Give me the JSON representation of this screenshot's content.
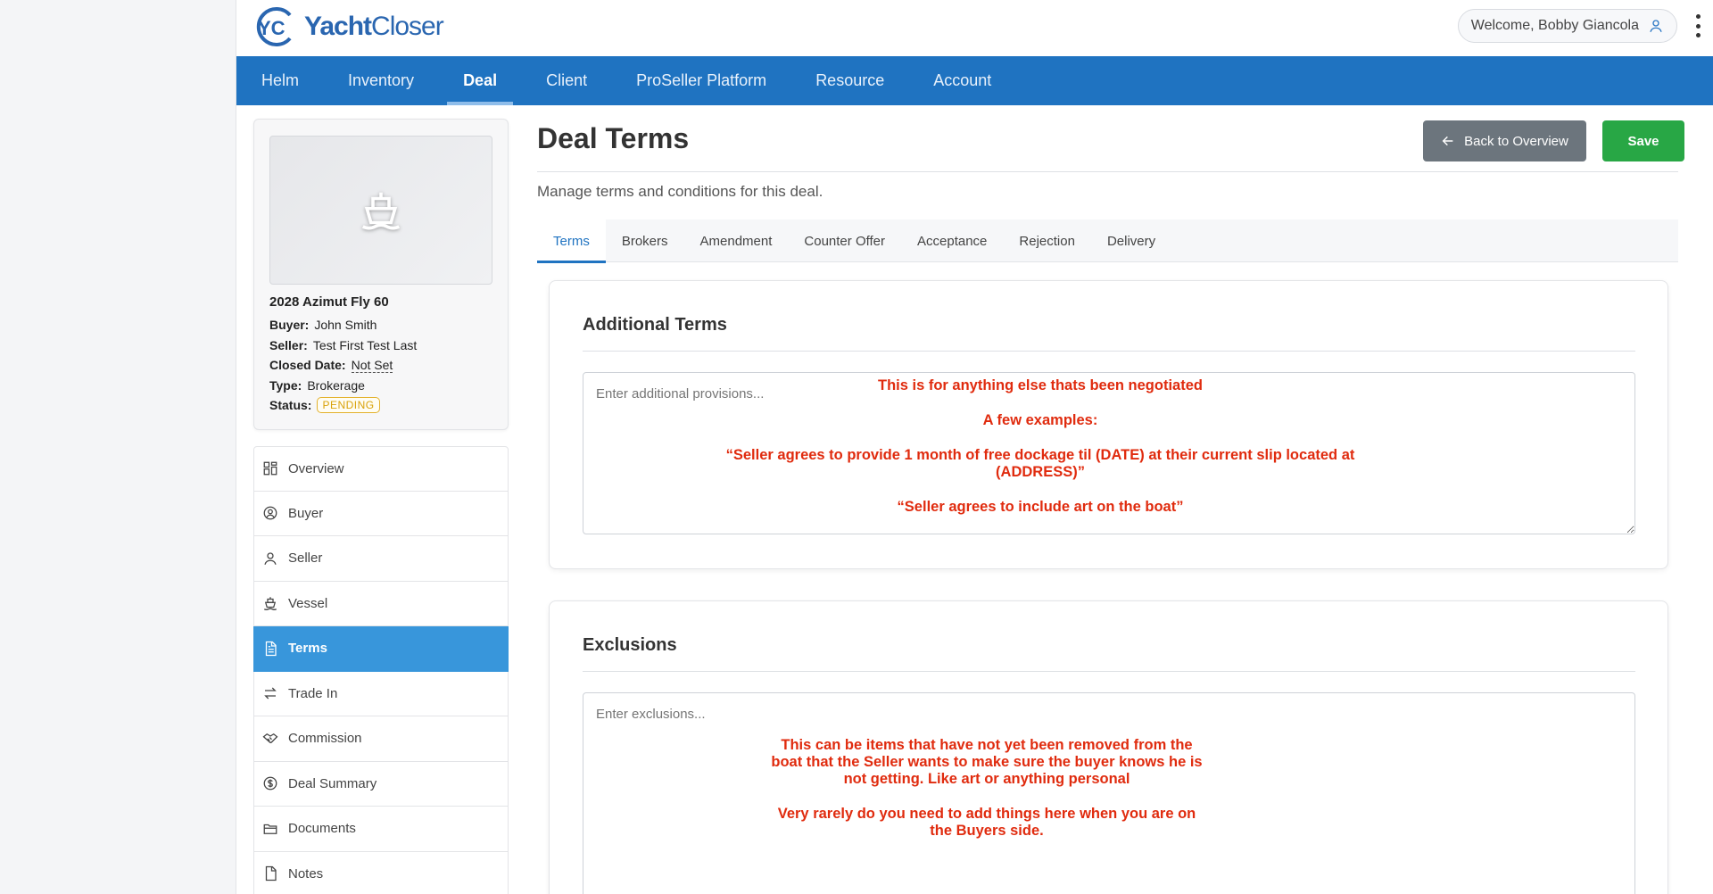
{
  "header": {
    "logo_mark": "YC",
    "logo_name_bold": "Yacht",
    "logo_name_light": "Closer",
    "welcome": "Welcome, Bobby Giancola"
  },
  "nav": [
    {
      "label": "Helm"
    },
    {
      "label": "Inventory"
    },
    {
      "label": "Deal",
      "active": true
    },
    {
      "label": "Client"
    },
    {
      "label": "ProSeller Platform"
    },
    {
      "label": "Resource"
    },
    {
      "label": "Account"
    }
  ],
  "deal": {
    "title": "2028 Azimut Fly 60",
    "buyer_label": "Buyer:",
    "buyer": "John Smith",
    "seller_label": "Seller:",
    "seller": "Test First Test Last",
    "closed_label": "Closed Date:",
    "closed": "Not Set",
    "type_label": "Type:",
    "type": "Brokerage",
    "status_label": "Status:",
    "status": "PENDING"
  },
  "side_menu": [
    {
      "label": "Overview",
      "icon": "grid-icon"
    },
    {
      "label": "Buyer",
      "icon": "user-circle-icon"
    },
    {
      "label": "Seller",
      "icon": "user-icon"
    },
    {
      "label": "Vessel",
      "icon": "ship-icon"
    },
    {
      "label": "Terms",
      "icon": "document-icon",
      "active": true
    },
    {
      "label": "Trade In",
      "icon": "swap-arrows-icon"
    },
    {
      "label": "Commission",
      "icon": "handshake-icon"
    },
    {
      "label": "Deal Summary",
      "icon": "dollar-circle-icon"
    },
    {
      "label": "Documents",
      "icon": "folder-icon"
    },
    {
      "label": "Notes",
      "icon": "file-icon"
    }
  ],
  "main": {
    "title": "Deal Terms",
    "subtitle": "Manage terms and conditions for this deal.",
    "back_label": "Back to Overview",
    "save_label": "Save",
    "tabs": [
      {
        "label": "Terms",
        "active": true
      },
      {
        "label": "Brokers"
      },
      {
        "label": "Amendment"
      },
      {
        "label": "Counter Offer"
      },
      {
        "label": "Acceptance"
      },
      {
        "label": "Rejection"
      },
      {
        "label": "Delivery"
      }
    ],
    "additional_terms": {
      "heading": "Additional Terms",
      "placeholder": "Enter additional provisions..."
    },
    "exclusions": {
      "heading": "Exclusions",
      "placeholder": "Enter exclusions..."
    }
  },
  "annotations": {
    "terms_1": "This is for anything else thats been negotiated",
    "terms_2": "A few examples:",
    "terms_3a": "“Seller agrees to provide 1 month of free dockage til (DATE) at their current slip located at",
    "terms_3b": "(ADDRESS)”",
    "terms_4": "“Seller agrees to include art on the boat”",
    "excl_1a": "This can be items that have not yet been removed from the",
    "excl_1b": "boat that the Seller wants to make sure the buyer knows he is",
    "excl_1c": "not getting. Like art or anything personal",
    "excl_2a": "Very rarely do you need to add things here when you are on",
    "excl_2b": "the Buyers side."
  },
  "colors": {
    "nav_blue": "#1f73c1",
    "menu_active": "#3896db",
    "save_green": "#28a745",
    "back_gray": "#6c757d",
    "annotation_red": "#e02b0e",
    "pending_gold": "#d9a20a"
  }
}
